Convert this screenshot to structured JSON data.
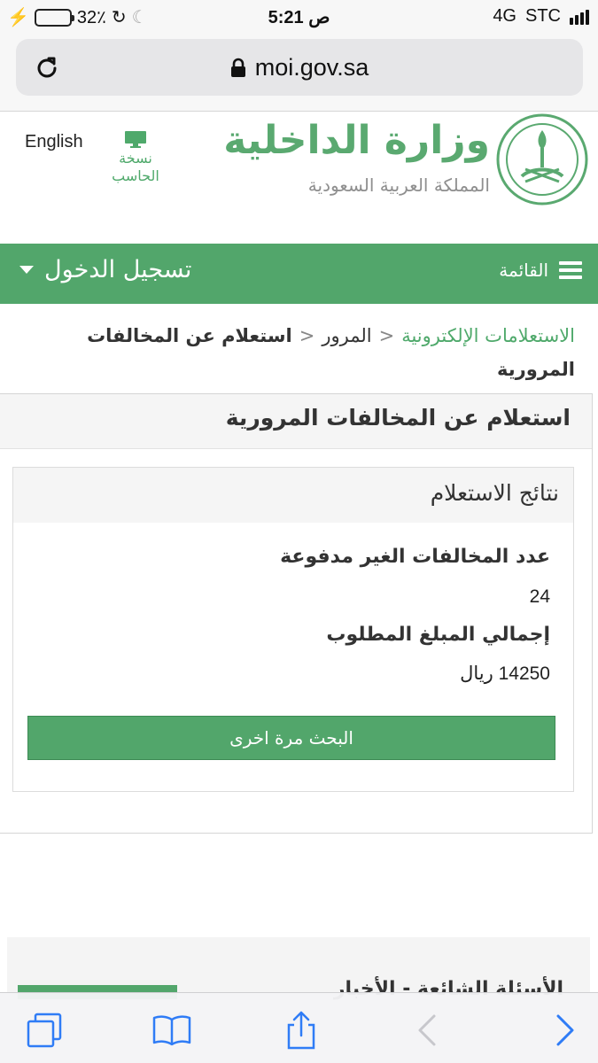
{
  "status_bar": {
    "battery": "32٪",
    "time": "5:21",
    "period": "ص",
    "network": "4G",
    "carrier": "STC"
  },
  "browser": {
    "url": "moi.gov.sa"
  },
  "header": {
    "language_link": "English",
    "desktop_version": "نسخة الحاسب",
    "logo_title": "وزارة الداخلية",
    "logo_subtitle": "المملكة العربية السعودية"
  },
  "nav": {
    "menu_label": "القائمة",
    "login_label": "تسجيل الدخول"
  },
  "breadcrumb": {
    "items": [
      "الاستعلامات الإلكترونية",
      "المرور"
    ],
    "current": "استعلام عن المخالفات المرورية"
  },
  "panel": {
    "title": "استعلام عن المخالفات المرورية",
    "results_title": "نتائج الاستعلام",
    "unpaid_label": "عدد المخالفات الغير مدفوعة",
    "unpaid_value": "24",
    "total_label": "إجمالي المبلغ المطلوب",
    "total_value": "14250 ريال",
    "search_again": "البحث مرة اخرى"
  },
  "footer": {
    "peek_text": "الأسئلة الشائعة - الأخبار"
  },
  "colors": {
    "brand_green": "#52a66b",
    "link_green": "#4fa96b"
  }
}
